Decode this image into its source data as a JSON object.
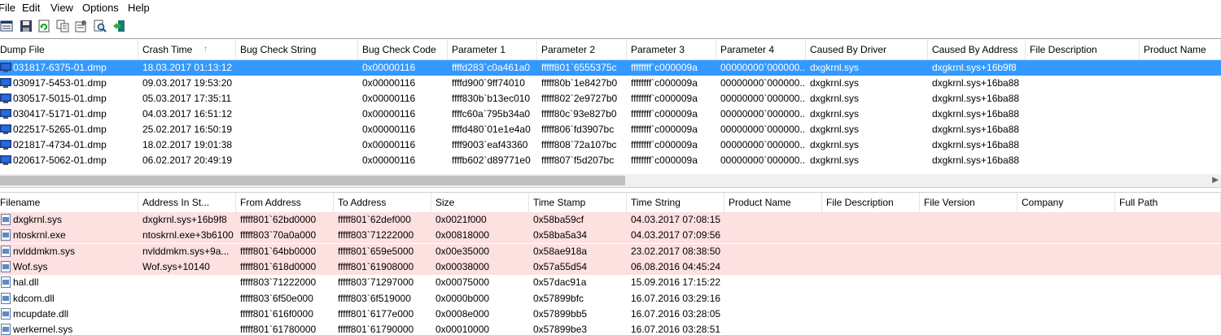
{
  "menu": [
    "File",
    "Edit",
    "View",
    "Options",
    "Help"
  ],
  "toolbar": [
    "properties-icon",
    "save-icon",
    "refresh-icon",
    "copy-icon",
    "html-report-icon",
    "find-icon",
    "exit-icon"
  ],
  "top": {
    "sort_arrow": "↑",
    "columns": [
      "Dump File",
      "Crash Time",
      "Bug Check String",
      "Bug Check Code",
      "Parameter 1",
      "Parameter 2",
      "Parameter 3",
      "Parameter 4",
      "Caused By Driver",
      "Caused By Address",
      "File Description",
      "Product Name"
    ],
    "rows": [
      [
        "031817-6375-01.dmp",
        "18.03.2017 01:13:12",
        "",
        "0x00000116",
        "ffffd283`c0a461a0",
        "fffff801`6555375c",
        "ffffffff`c000009a",
        "00000000`000000...",
        "dxgkrnl.sys",
        "dxgkrnl.sys+16b9f8",
        "",
        ""
      ],
      [
        "030917-5453-01.dmp",
        "09.03.2017 19:53:20",
        "",
        "0x00000116",
        "ffffd900`9ff74010",
        "fffff80b`1e8427b0",
        "ffffffff`c000009a",
        "00000000`000000...",
        "dxgkrnl.sys",
        "dxgkrnl.sys+16ba88",
        "",
        ""
      ],
      [
        "030517-5015-01.dmp",
        "05.03.2017 17:35:11",
        "",
        "0x00000116",
        "ffff830b`b13ec010",
        "fffff802`2e9727b0",
        "ffffffff`c000009a",
        "00000000`000000...",
        "dxgkrnl.sys",
        "dxgkrnl.sys+16ba88",
        "",
        ""
      ],
      [
        "030417-5171-01.dmp",
        "04.03.2017 16:51:12",
        "",
        "0x00000116",
        "ffffc60a`795b34a0",
        "fffff80c`93e827b0",
        "ffffffff`c000009a",
        "00000000`000000...",
        "dxgkrnl.sys",
        "dxgkrnl.sys+16ba88",
        "",
        ""
      ],
      [
        "022517-5265-01.dmp",
        "25.02.2017 16:50:19",
        "",
        "0x00000116",
        "ffffd480`01e1e4a0",
        "fffff806`fd3907bc",
        "ffffffff`c000009a",
        "00000000`000000...",
        "dxgkrnl.sys",
        "dxgkrnl.sys+16ba88",
        "",
        ""
      ],
      [
        "021817-4734-01.dmp",
        "18.02.2017 19:01:38",
        "",
        "0x00000116",
        "ffff9003`eaf43360",
        "fffff808`72a107bc",
        "ffffffff`c000009a",
        "00000000`000000...",
        "dxgkrnl.sys",
        "dxgkrnl.sys+16ba88",
        "",
        ""
      ],
      [
        "020617-5062-01.dmp",
        "06.02.2017 20:49:19",
        "",
        "0x00000116",
        "ffffb602`d89771e0",
        "fffff807`f5d207bc",
        "ffffffff`c000009a",
        "00000000`000000...",
        "dxgkrnl.sys",
        "dxgkrnl.sys+16ba88",
        "",
        ""
      ]
    ]
  },
  "bottom": {
    "columns": [
      "Filename",
      "Address In St...",
      "From Address",
      "To Address",
      "Size",
      "Time Stamp",
      "Time String",
      "Product Name",
      "File Description",
      "File Version",
      "Company",
      "Full Path"
    ],
    "rows": [
      [
        "dxgkrnl.sys",
        "dxgkrnl.sys+16b9f8",
        "fffff801`62bd0000",
        "fffff801`62def000",
        "0x0021f000",
        "0x58ba59cf",
        "04.03.2017 07:08:15",
        "",
        "",
        "",
        "",
        ""
      ],
      [
        "ntoskrnl.exe",
        "ntoskrnl.exe+3b6100",
        "fffff803`70a0a000",
        "fffff803`71222000",
        "0x00818000",
        "0x58ba5a34",
        "04.03.2017 07:09:56",
        "",
        "",
        "",
        "",
        ""
      ],
      [
        "nvlddmkm.sys",
        "nvlddmkm.sys+9a...",
        "fffff801`64bb0000",
        "fffff801`659e5000",
        "0x00e35000",
        "0x58ae918a",
        "23.02.2017 08:38:50",
        "",
        "",
        "",
        "",
        ""
      ],
      [
        "Wof.sys",
        "Wof.sys+10140",
        "fffff801`618d0000",
        "fffff801`61908000",
        "0x00038000",
        "0x57a55d54",
        "06.08.2016 04:45:24",
        "",
        "",
        "",
        "",
        ""
      ],
      [
        "hal.dll",
        "",
        "fffff803`71222000",
        "fffff803`71297000",
        "0x00075000",
        "0x57dac91a",
        "15.09.2016 17:15:22",
        "",
        "",
        "",
        "",
        ""
      ],
      [
        "kdcom.dll",
        "",
        "fffff803`6f50e000",
        "fffff803`6f519000",
        "0x0000b000",
        "0x57899bfc",
        "16.07.2016 03:29:16",
        "",
        "",
        "",
        "",
        ""
      ],
      [
        "mcupdate.dll",
        "",
        "fffff801`616f0000",
        "fffff801`6177e000",
        "0x0008e000",
        "0x57899bb5",
        "16.07.2016 03:28:05",
        "",
        "",
        "",
        "",
        ""
      ],
      [
        "werkernel.sys",
        "",
        "fffff801`61780000",
        "fffff801`61790000",
        "0x00010000",
        "0x57899be3",
        "16.07.2016 03:28:51",
        "",
        "",
        "",
        "",
        ""
      ]
    ]
  },
  "colors": {
    "selection": "#3399ff",
    "highlight_row": "#fde0e0"
  }
}
